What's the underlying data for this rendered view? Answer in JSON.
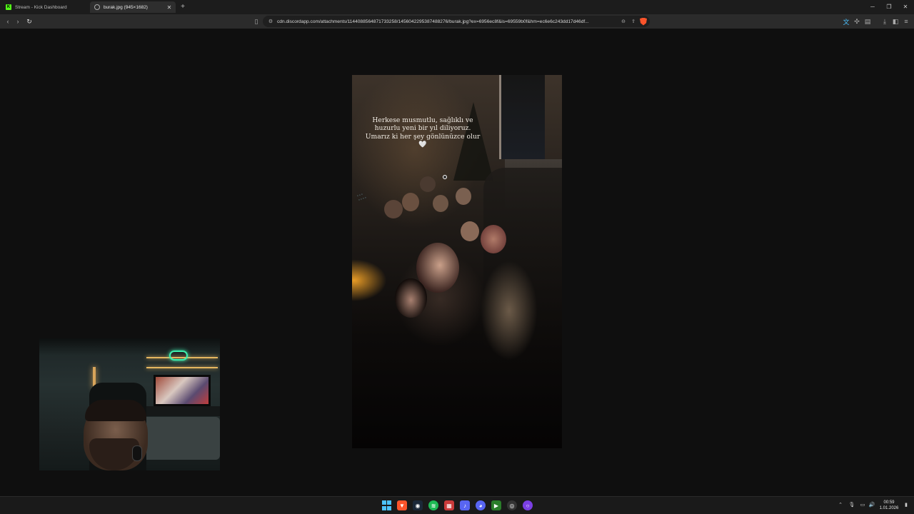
{
  "tabs": [
    {
      "title": "Stream - Kick Dashboard",
      "icon": "kick-icon",
      "active": false
    },
    {
      "title": "burak.jpg (945×1682)",
      "icon": "globe-icon",
      "active": true
    }
  ],
  "toolbar": {
    "url": "cdn.discordapp.com/attachments/1144088564871733258/1456042295387488276/burak.jpg?ex=6956ec8f&is=69559b0f&hm=ec6e6c243dd17d46df..."
  },
  "photo": {
    "caption": "Herkese musmutlu, sağlıklı ve huzurlu yeni bir yıl diliyoruz. Umarız ki her şey gönlünüzce olur 🤍"
  },
  "taskbar": {
    "time": "00:59",
    "date": "1.01.2026"
  },
  "colors": {
    "brave": "#fb542b",
    "kick": "#53fc18",
    "windows_blue": "#4cc2ff"
  }
}
